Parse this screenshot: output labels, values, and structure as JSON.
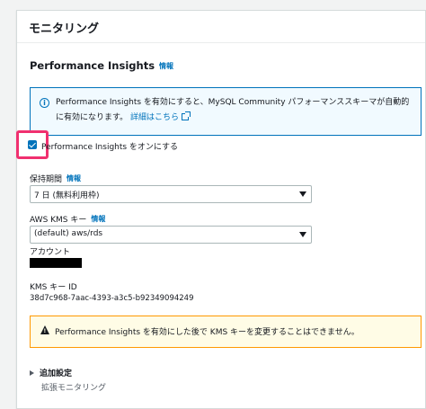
{
  "panel": {
    "title": "モニタリング"
  },
  "performance_insights": {
    "section_title": "Performance Insights",
    "info_label": "情報",
    "info_box": {
      "text": "Performance Insights を有効にすると、MySQL Community パフォーマンススキーマが自動的に有効になります。",
      "link_label": "詳細はこちら"
    },
    "enable_checkbox": {
      "label": "Performance Insights をオンにする",
      "checked": true
    },
    "retention": {
      "label": "保持期間",
      "info_label": "情報",
      "value": "7 日 (無料利用枠)"
    },
    "kms_key": {
      "label": "AWS KMS キー",
      "info_label": "情報",
      "value": "(default) aws/rds"
    },
    "account": {
      "label": "アカウント"
    },
    "kms_key_id": {
      "label": "KMS キー ID",
      "value": "38d7c968-7aac-4393-a3c5-b92349094249"
    },
    "warning": {
      "text": "Performance Insights を有効にした後で KMS キーを変更することはできません。"
    }
  },
  "additional": {
    "expander_label": "追加設定",
    "sub_label": "拡張モニタリング"
  },
  "colors": {
    "link": "#0073bb",
    "highlight": "#f0306f",
    "warning_border": "#ff9900",
    "info_bg": "#f1faff"
  }
}
